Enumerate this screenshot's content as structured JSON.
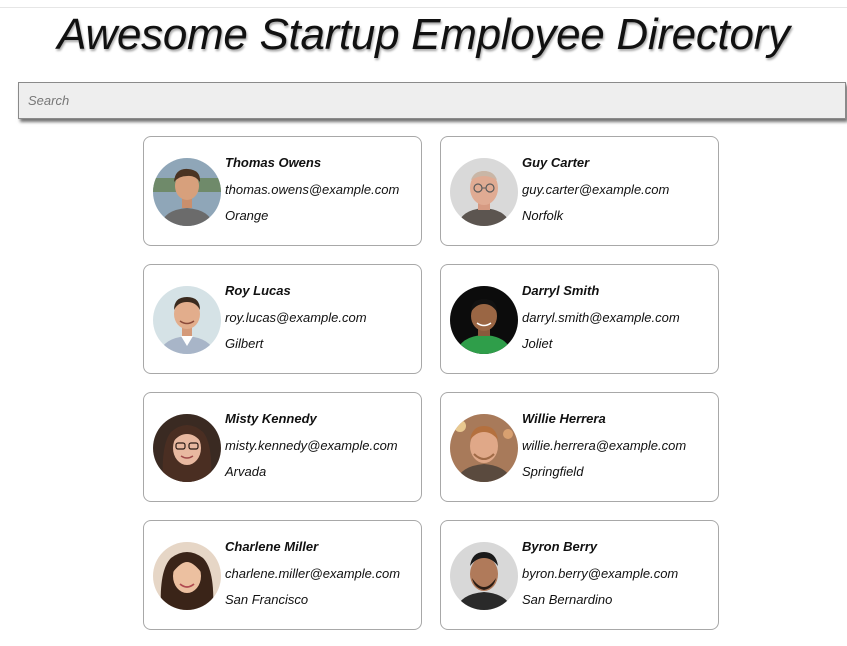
{
  "page": {
    "title": "Awesome Startup Employee Directory"
  },
  "search": {
    "placeholder": "Search",
    "value": ""
  },
  "employees": [
    {
      "name": "Thomas Owens",
      "email": "thomas.owens@example.com",
      "city": "Orange"
    },
    {
      "name": "Guy Carter",
      "email": "guy.carter@example.com",
      "city": "Norfolk"
    },
    {
      "name": "Roy Lucas",
      "email": "roy.lucas@example.com",
      "city": "Gilbert"
    },
    {
      "name": "Darryl Smith",
      "email": "darryl.smith@example.com",
      "city": "Joliet"
    },
    {
      "name": "Misty Kennedy",
      "email": "misty.kennedy@example.com",
      "city": "Arvada"
    },
    {
      "name": "Willie Herrera",
      "email": "willie.herrera@example.com",
      "city": "Springfield"
    },
    {
      "name": "Charlene Miller",
      "email": "charlene.miller@example.com",
      "city": "San Francisco"
    },
    {
      "name": "Byron Berry",
      "email": "byron.berry@example.com",
      "city": "San Bernardino"
    }
  ]
}
